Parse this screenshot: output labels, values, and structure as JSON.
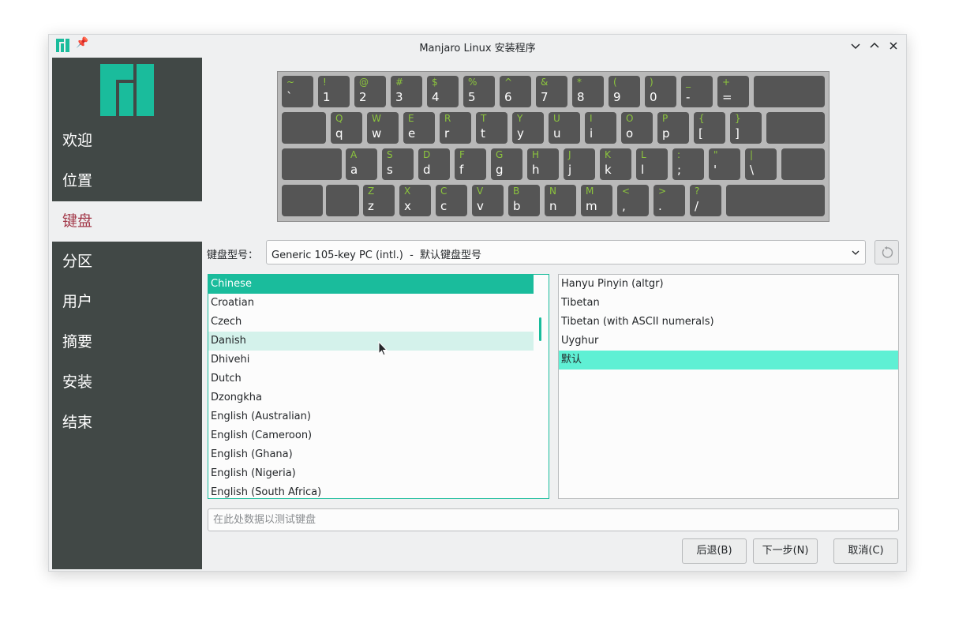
{
  "window": {
    "title": "Manjaro Linux 安装程序"
  },
  "sidebar": {
    "items": [
      {
        "label": "欢迎"
      },
      {
        "label": "位置"
      },
      {
        "label": "键盘"
      },
      {
        "label": "分区"
      },
      {
        "label": "用户"
      },
      {
        "label": "摘要"
      },
      {
        "label": "安装"
      },
      {
        "label": "结束"
      }
    ],
    "active": "键盘"
  },
  "keyboard": {
    "rows": [
      [
        [
          "~",
          "`"
        ],
        [
          "!",
          "1"
        ],
        [
          "@",
          "2"
        ],
        [
          "#",
          "3"
        ],
        [
          "$",
          "4"
        ],
        [
          "%",
          "5"
        ],
        [
          "^",
          "6"
        ],
        [
          "&",
          "7"
        ],
        [
          "*",
          "8"
        ],
        [
          "(",
          "9"
        ],
        [
          ")",
          "0"
        ],
        [
          "_",
          "-"
        ],
        [
          "+",
          "="
        ]
      ],
      [
        [
          "Q",
          "q"
        ],
        [
          "W",
          "w"
        ],
        [
          "E",
          "e"
        ],
        [
          "R",
          "r"
        ],
        [
          "T",
          "t"
        ],
        [
          "Y",
          "y"
        ],
        [
          "U",
          "u"
        ],
        [
          "I",
          "i"
        ],
        [
          "O",
          "o"
        ],
        [
          "P",
          "p"
        ],
        [
          "{",
          "["
        ],
        [
          "}",
          "]"
        ]
      ],
      [
        [
          "A",
          "a"
        ],
        [
          "S",
          "s"
        ],
        [
          "D",
          "d"
        ],
        [
          "F",
          "f"
        ],
        [
          "G",
          "g"
        ],
        [
          "H",
          "h"
        ],
        [
          "J",
          "j"
        ],
        [
          "K",
          "k"
        ],
        [
          "L",
          "l"
        ],
        [
          ":",
          ";"
        ],
        [
          "\"",
          "'"
        ],
        [
          "|",
          "\\"
        ]
      ],
      [
        [
          "Z",
          "z"
        ],
        [
          "X",
          "x"
        ],
        [
          "C",
          "c"
        ],
        [
          "V",
          "v"
        ],
        [
          "B",
          "b"
        ],
        [
          "N",
          "n"
        ],
        [
          "M",
          "m"
        ],
        [
          "<",
          ","
        ],
        [
          ">",
          "."
        ],
        [
          "?",
          "/"
        ]
      ]
    ]
  },
  "model": {
    "label": "键盘型号：",
    "value": "Generic 105-key PC (intl.)  -  默认键盘型号"
  },
  "layouts": {
    "items": [
      "Chinese",
      "Croatian",
      "Czech",
      "Danish",
      "Dhivehi",
      "Dutch",
      "Dzongkha",
      "English (Australian)",
      "English (Cameroon)",
      "English (Ghana)",
      "English (Nigeria)",
      "English (South Africa)"
    ],
    "selected": "Chinese",
    "hovered": "Danish"
  },
  "variants": {
    "items": [
      "Hanyu Pinyin (altgr)",
      "Tibetan",
      "Tibetan (with ASCII numerals)",
      "Uyghur",
      "默认"
    ],
    "selected": "默认"
  },
  "test_input": {
    "placeholder": "在此处数据以测试键盘"
  },
  "buttons": {
    "back": "后退(B)",
    "next": "下一步(N)",
    "cancel": "取消(C)"
  },
  "colors": {
    "accent": "#1abc9c",
    "sidebar_bg": "#414846",
    "active_text": "#a33a4a",
    "key_shift": "#8cc53d"
  }
}
